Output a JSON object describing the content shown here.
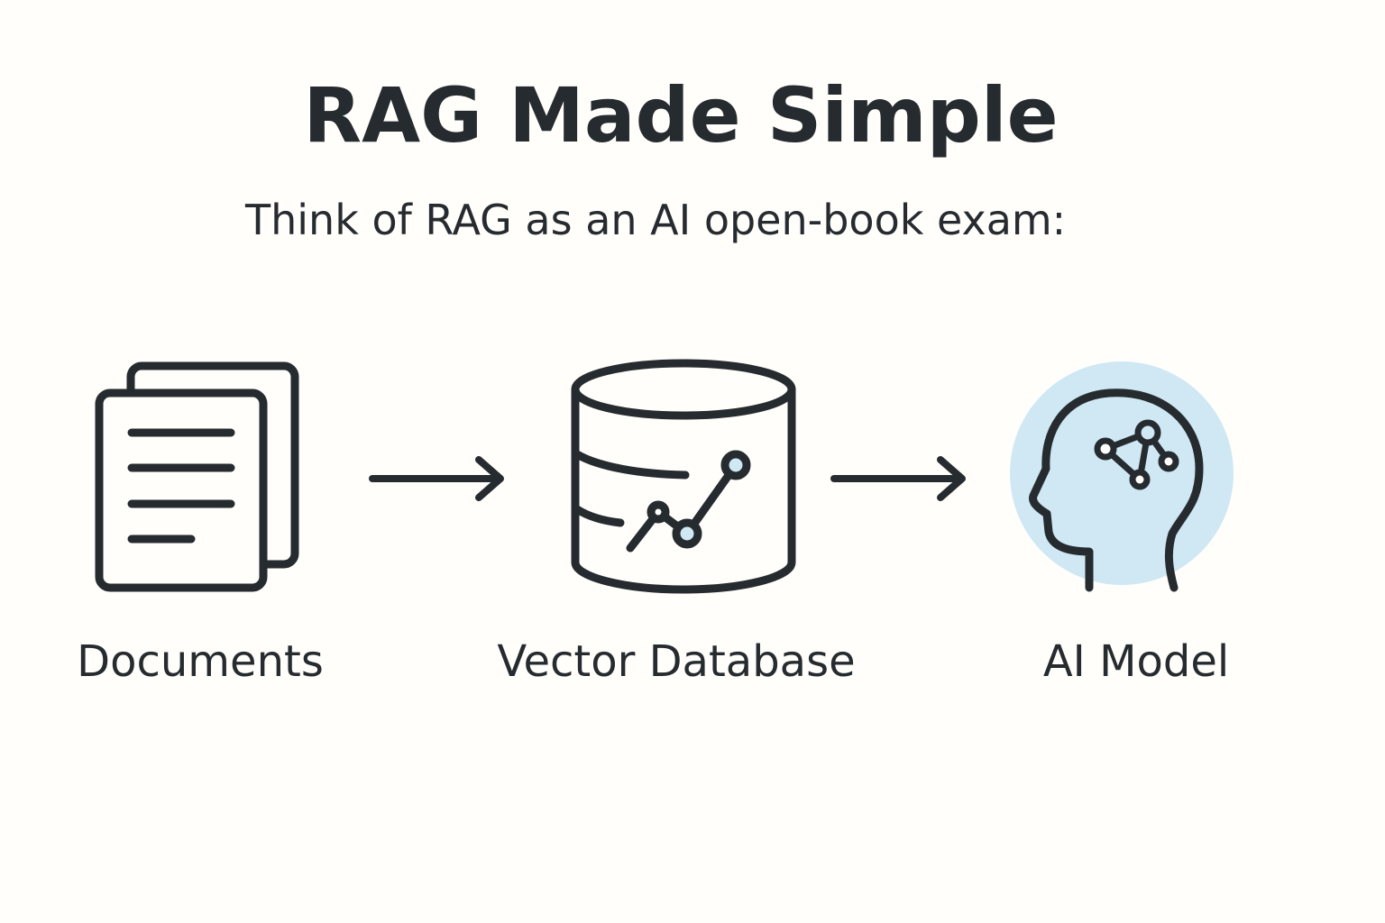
{
  "title": "RAG Made Simple",
  "subtitle": "Think of RAG as an AI open-book exam:",
  "nodes": [
    {
      "label": "Documents",
      "icon": "documents-icon"
    },
    {
      "label": "Vector Database",
      "icon": "database-icon"
    },
    {
      "label": "AI Model",
      "icon": "ai-head-icon"
    }
  ],
  "colors": {
    "ink": "#262b2f",
    "accent_light_blue": "#cfe8f3",
    "background": "#fffefb"
  }
}
